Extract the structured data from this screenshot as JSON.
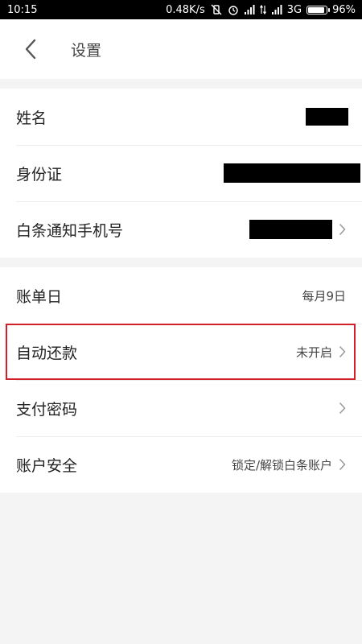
{
  "status": {
    "time": "10:15",
    "speed": "0.48K/s",
    "network": "3G",
    "battery": "96%"
  },
  "header": {
    "title": "设置",
    "back_icon": "chevron-left-icon"
  },
  "section1": {
    "rows": [
      {
        "label": "姓名",
        "value": "",
        "redacted": true
      },
      {
        "label": "身份证",
        "value": "",
        "redacted": true
      },
      {
        "label": "白条通知手机号",
        "value": "",
        "redacted": true,
        "chevron": true
      }
    ]
  },
  "section2": {
    "rows": [
      {
        "label": "账单日",
        "value": "每月9日",
        "chevron": false
      },
      {
        "label": "自动还款",
        "value": "未开启",
        "chevron": true,
        "highlighted": true
      },
      {
        "label": "支付密码",
        "value": "",
        "chevron": true
      },
      {
        "label": "账户安全",
        "value": "锁定/解锁白条账户",
        "chevron": true
      }
    ]
  },
  "colors": {
    "highlight": "#d21f2a",
    "background": "#f4f4f4"
  }
}
